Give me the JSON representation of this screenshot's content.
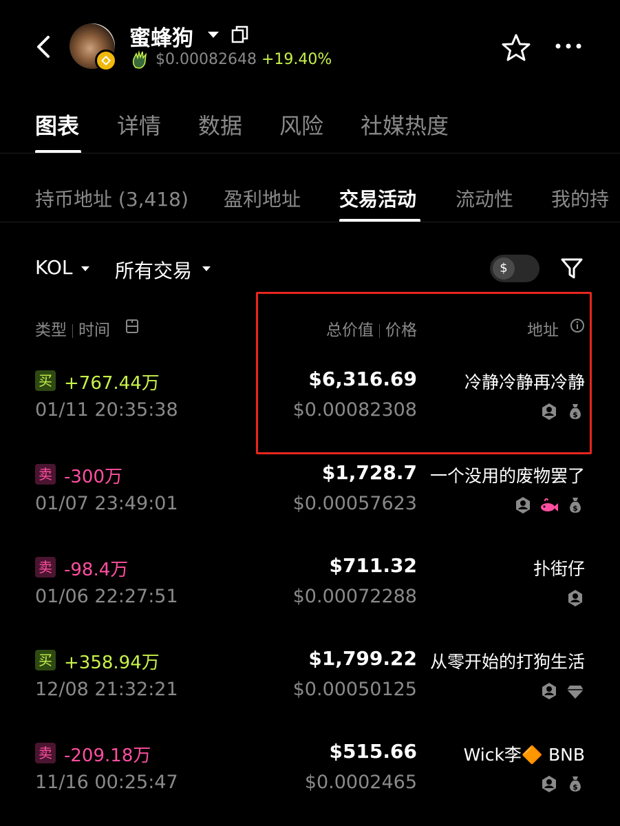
{
  "header": {
    "title": "蜜蜂狗",
    "price": "$0.00082648",
    "change": "+19.40%"
  },
  "main_tabs": [
    {
      "label": "图表",
      "active": true
    },
    {
      "label": "详情"
    },
    {
      "label": "数据"
    },
    {
      "label": "风险"
    },
    {
      "label": "社媒热度"
    }
  ],
  "sub_tabs": [
    {
      "label": "持币地址 (3,418)"
    },
    {
      "label": "盈利地址"
    },
    {
      "label": "交易活动",
      "active": true
    },
    {
      "label": "流动性"
    },
    {
      "label": "我的持"
    }
  ],
  "filters": {
    "kol": "KOL",
    "all_trades": "所有交易",
    "toggle_symbol": "$"
  },
  "columns": {
    "type": "类型",
    "time": "时间",
    "total": "总价值",
    "price": "价格",
    "address": "地址"
  },
  "rows": [
    {
      "side": "买",
      "kind": "buy",
      "amount": "+767.44万",
      "time": "01/11 20:35:38",
      "total": "$6,316.69",
      "price": "$0.00082308",
      "address": "冷静冷静再冷静",
      "icons": [
        "kol-badge-icon",
        "money-bag-icon"
      ]
    },
    {
      "side": "卖",
      "kind": "sell",
      "amount": "-300万",
      "time": "01/07 23:49:01",
      "total": "$1,728.7",
      "price": "$0.00057623",
      "address": "一个没用的废物罢了",
      "icons": [
        "kol-badge-icon",
        "fish-icon",
        "money-bag-icon"
      ]
    },
    {
      "side": "卖",
      "kind": "sell",
      "amount": "-98.4万",
      "time": "01/06 22:27:51",
      "total": "$711.32",
      "price": "$0.00072288",
      "address": "扑街仔",
      "icons": [
        "kol-badge-icon"
      ]
    },
    {
      "side": "买",
      "kind": "buy",
      "amount": "+358.94万",
      "time": "12/08 21:32:21",
      "total": "$1,799.22",
      "price": "$0.00050125",
      "address": "从零开始的打狗生活",
      "icons": [
        "kol-badge-icon",
        "diamond-icon"
      ]
    },
    {
      "side": "卖",
      "kind": "sell",
      "amount": "-209.18万",
      "time": "11/16 00:25:47",
      "total": "$515.66",
      "price": "$0.0002465",
      "address": "Wick李🔶 BNB",
      "icons": [
        "kol-badge-icon",
        "money-bag-icon"
      ]
    }
  ]
}
